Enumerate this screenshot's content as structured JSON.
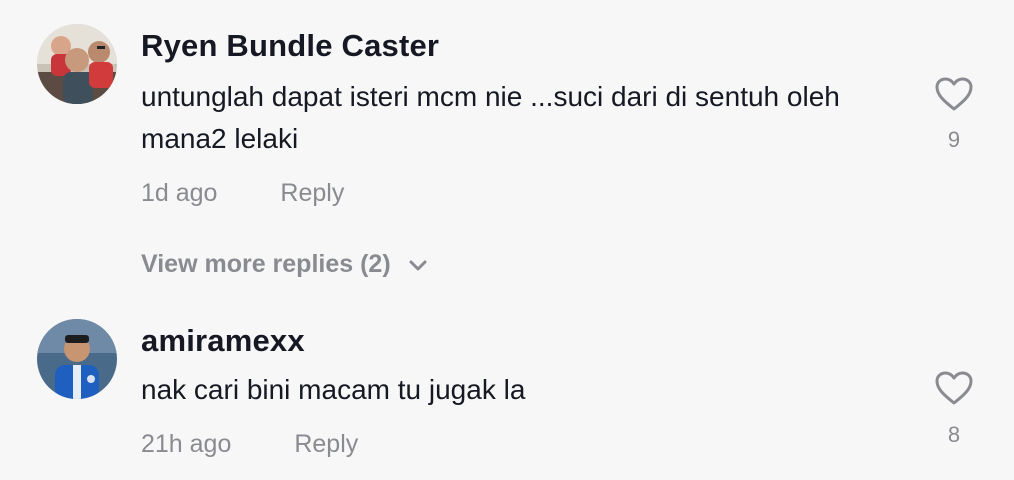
{
  "comments": [
    {
      "username": "Ryen Bundle Caster",
      "text": "untunglah dapat isteri mcm nie ...suci dari di sentuh oleh mana2 lelaki",
      "time": "1d ago",
      "reply_label": "Reply",
      "likes": "9",
      "like_icon": "heart-outline-icon"
    },
    {
      "username": "amiramexx",
      "text": "nak cari bini macam tu jugak la",
      "time": "21h ago",
      "reply_label": "Reply",
      "likes": "8",
      "like_icon": "heart-outline-icon"
    }
  ],
  "view_more": {
    "label": "View more replies (2)",
    "icon": "chevron-down-icon"
  },
  "colors": {
    "background": "#f7f7f7",
    "primary_text": "#161823",
    "secondary_text": "#8a8b91"
  }
}
